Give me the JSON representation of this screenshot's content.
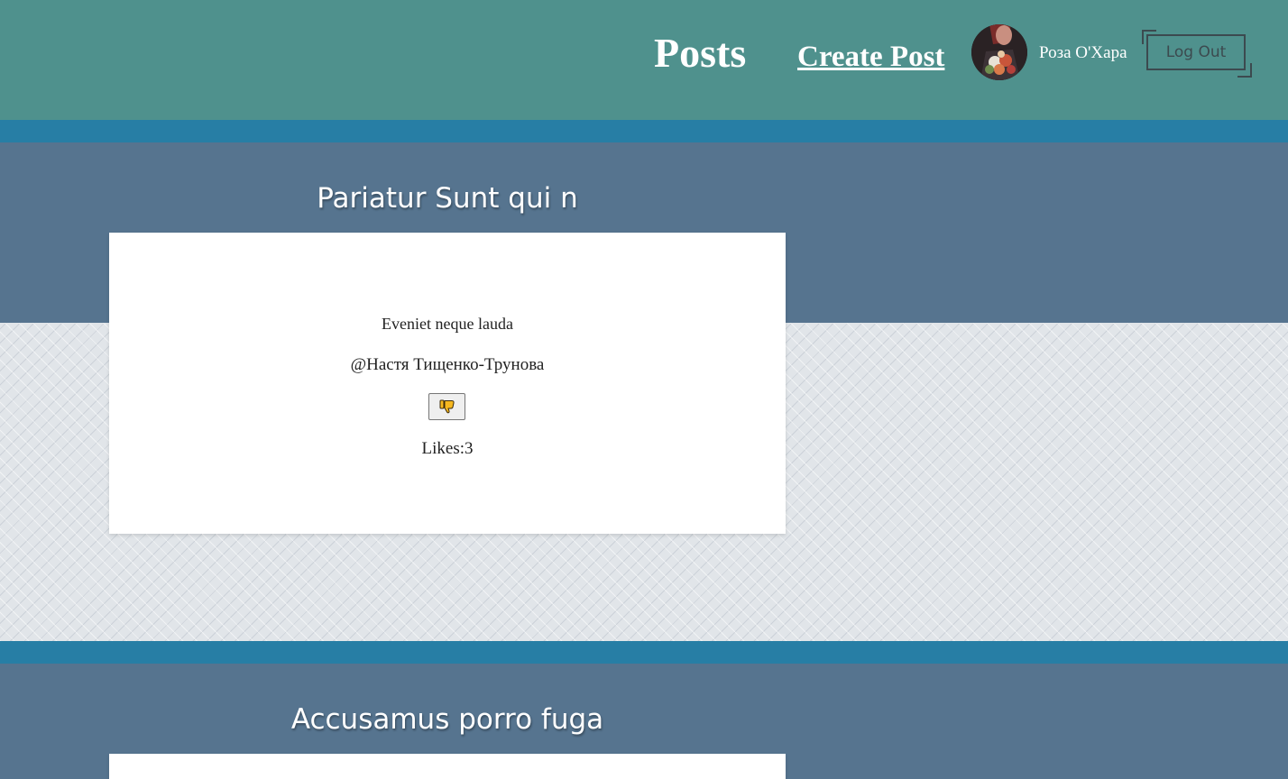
{
  "header": {
    "nav_posts": "Posts",
    "nav_create_post": "Create Post",
    "username": "Роза О'Хара",
    "logout_label": "Log Out"
  },
  "posts": [
    {
      "title": "Pariatur Sunt qui n",
      "body": "Eveniet neque lauda",
      "author": "@Настя Тищенко-Трунова",
      "dislike_icon": "thumbs-down-icon",
      "likes": "Likes:3"
    },
    {
      "title": "Accusamus porro fuga"
    }
  ],
  "colors": {
    "header_bg": "#4f918d",
    "stripe": "#277ea5",
    "band": "#56748f",
    "page_bg": "#e1e5e9"
  }
}
